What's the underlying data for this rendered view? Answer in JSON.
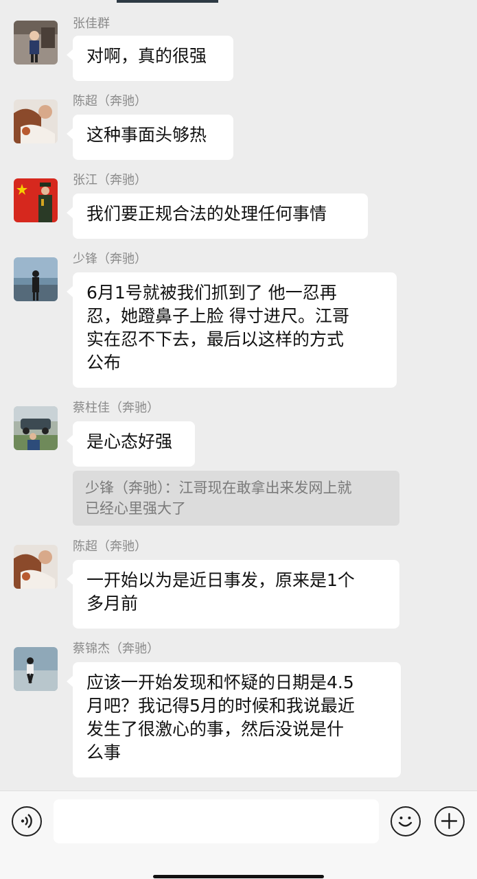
{
  "messages": [
    {
      "sender": "张佳群",
      "text": "对啊，真的很强"
    },
    {
      "sender": "陈超（奔驰）",
      "text": "这种事面头够热"
    },
    {
      "sender": "张江（奔驰）",
      "text": "我们要正规合法的处理任何事情"
    },
    {
      "sender": "少锋（奔驰）",
      "lines": [
        "6月1号就被我们抓到了  他一忍再",
        "忍，她蹬鼻子上脸  得寸进尺。江哥",
        "实在忍不下去，最后以这样的方式",
        "公布"
      ]
    },
    {
      "sender": "蔡柱佳（奔驰）",
      "text": "是心态好强",
      "quote_lines": [
        "少锋（奔驰）：江哥现在敢拿出来发网上就",
        "已经心里强大了"
      ]
    },
    {
      "sender": "陈超（奔驰）",
      "lines": [
        "一开始以为是近日事发，原来是1个",
        "多月前"
      ]
    },
    {
      "sender": "蔡锦杰（奔驰）",
      "lines": [
        "应该一开始发现和怀疑的日期是4.5",
        "月吧？我记得5月的时候和我说最近",
        "发生了很激心的事，然后没说是什",
        "么事"
      ]
    }
  ],
  "input_bar": {
    "placeholder": "",
    "voice_icon": "voice-icon",
    "emoji_icon": "emoji-icon",
    "plus_icon": "plus-icon"
  }
}
